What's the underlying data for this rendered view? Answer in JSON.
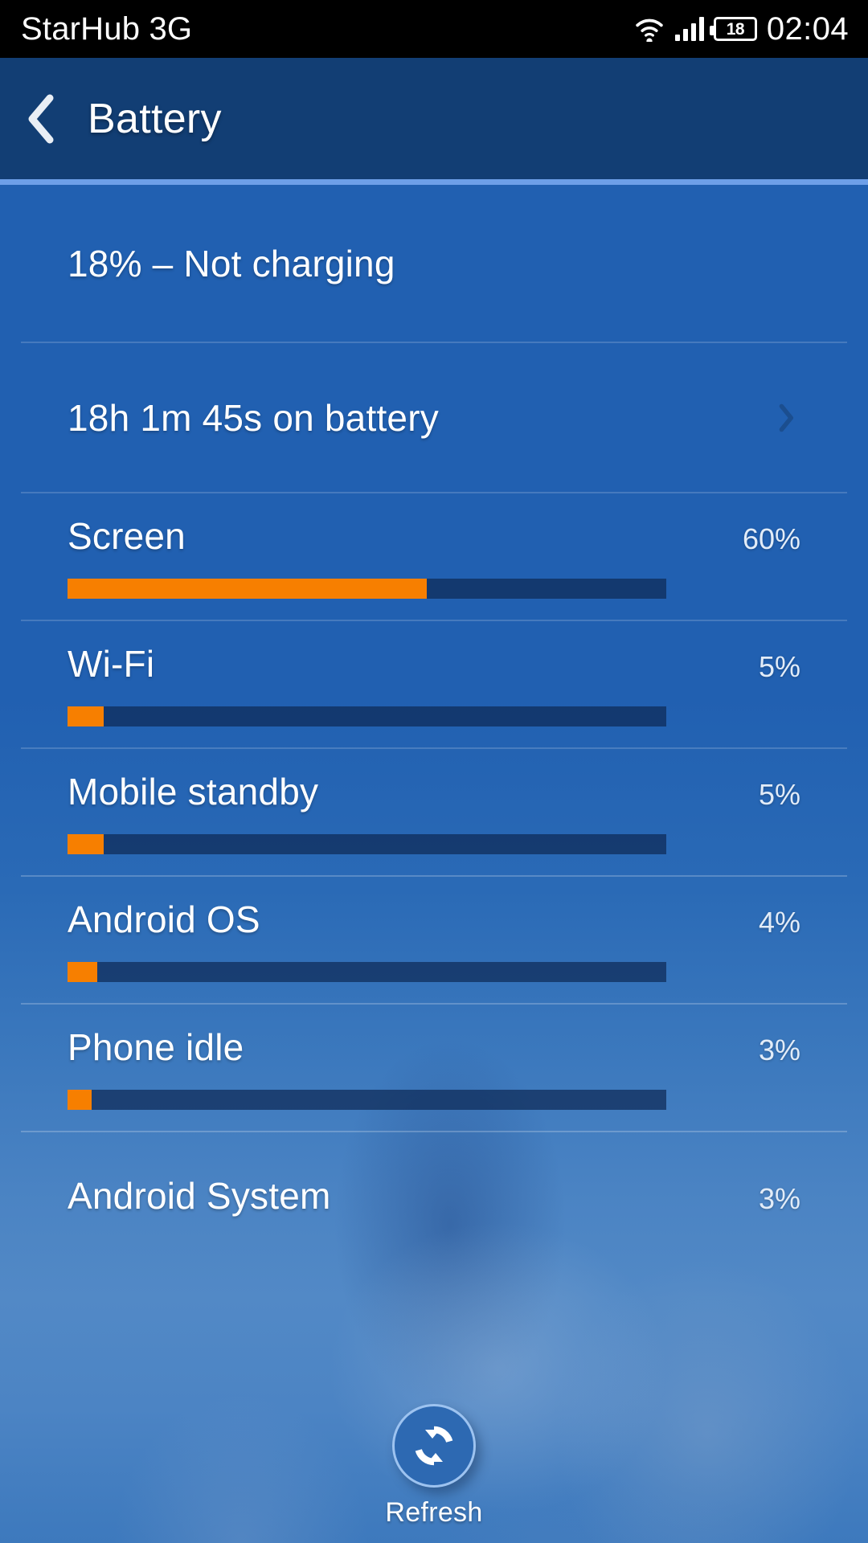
{
  "status_bar": {
    "carrier": "StarHub 3G",
    "clock": "02:04",
    "battery_level": "18",
    "icons": [
      "wifi-icon",
      "signal-icon",
      "battery-icon"
    ]
  },
  "header": {
    "title": "Battery",
    "back_icon": "chevron-left-icon",
    "background_color": "#123e74",
    "accent_color": "#6d9fe8"
  },
  "summary": [
    {
      "text": "18% – Not charging",
      "has_chevron": false
    },
    {
      "text": "18h 1m 45s on battery",
      "has_chevron": true
    }
  ],
  "usage": {
    "bar_color": "#f77f00",
    "track_color": "#0e2a56",
    "items": [
      {
        "name": "Screen",
        "percent_label": "60%",
        "percent": 60,
        "bar_ratio": 60,
        "has_bar": true
      },
      {
        "name": "Wi-Fi",
        "percent_label": "5%",
        "percent": 5,
        "bar_ratio": 6,
        "has_bar": true
      },
      {
        "name": "Mobile standby",
        "percent_label": "5%",
        "percent": 5,
        "bar_ratio": 6,
        "has_bar": true
      },
      {
        "name": "Android OS",
        "percent_label": "4%",
        "percent": 4,
        "bar_ratio": 5,
        "has_bar": true
      },
      {
        "name": "Phone idle",
        "percent_label": "3%",
        "percent": 3,
        "bar_ratio": 4,
        "has_bar": true
      },
      {
        "name": "Android System",
        "percent_label": "3%",
        "percent": 3,
        "bar_ratio": 4,
        "has_bar": false
      }
    ]
  },
  "refresh": {
    "label": "Refresh",
    "icon": "refresh-icon"
  }
}
